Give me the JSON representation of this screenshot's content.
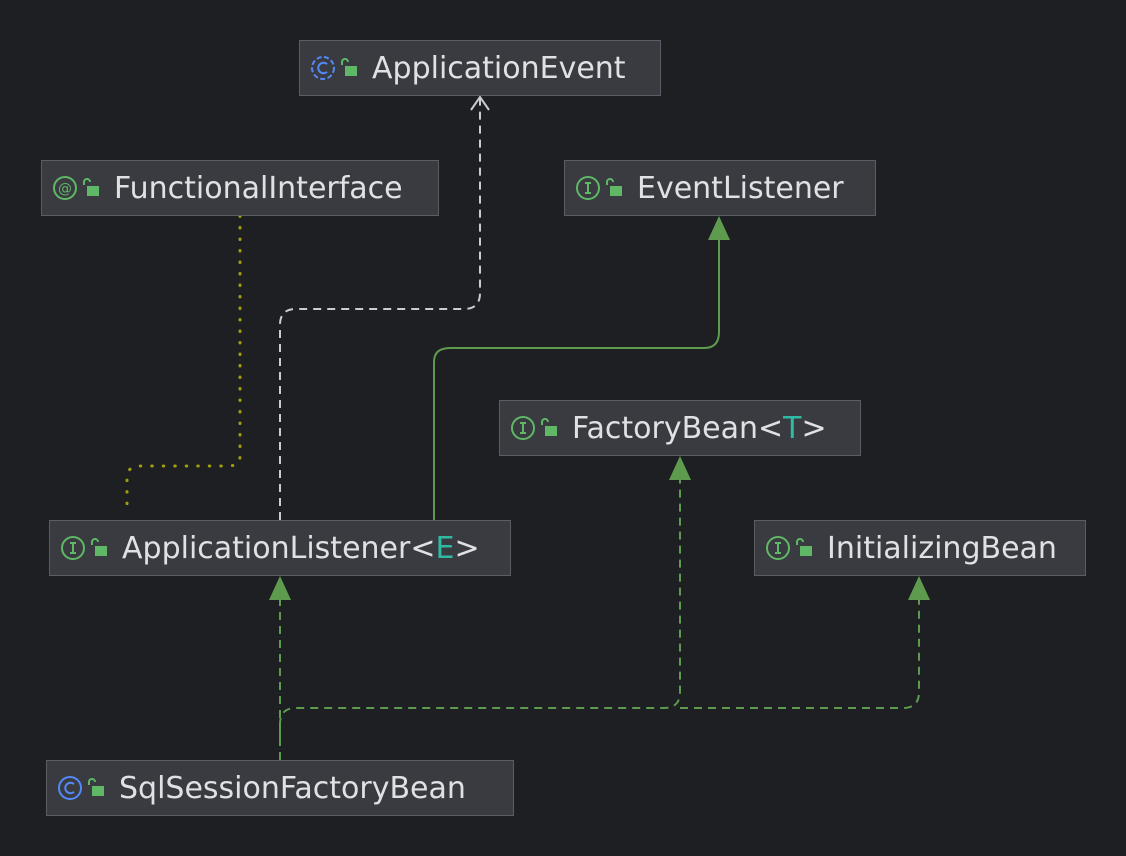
{
  "diagram": {
    "nodes": [
      {
        "id": "application-event",
        "name": "ApplicationEvent",
        "kind": "class",
        "type_param": null
      },
      {
        "id": "functional-interface",
        "name": "FunctionalInterface",
        "kind": "annotation",
        "type_param": null
      },
      {
        "id": "event-listener",
        "name": "EventListener",
        "kind": "interface",
        "type_param": null
      },
      {
        "id": "factory-bean",
        "name": "FactoryBean",
        "kind": "interface",
        "type_param": "T"
      },
      {
        "id": "application-listener",
        "name": "ApplicationListener",
        "kind": "interface",
        "type_param": "E"
      },
      {
        "id": "initializing-bean",
        "name": "InitializingBean",
        "kind": "interface",
        "type_param": null
      },
      {
        "id": "sql-session-factory-bean",
        "name": "SqlSessionFactoryBean",
        "kind": "class",
        "type_param": null
      }
    ],
    "edges": [
      {
        "from": "application-listener",
        "to": "application-event",
        "relation": "dependency"
      },
      {
        "from": "application-listener",
        "to": "event-listener",
        "relation": "extends"
      },
      {
        "from": "application-listener",
        "to": "functional-interface",
        "relation": "annotated-by"
      },
      {
        "from": "sql-session-factory-bean",
        "to": "application-listener",
        "relation": "implements"
      },
      {
        "from": "sql-session-factory-bean",
        "to": "factory-bean",
        "relation": "implements"
      },
      {
        "from": "sql-session-factory-bean",
        "to": "initializing-bean",
        "relation": "implements"
      }
    ]
  },
  "colors": {
    "background": "#1e1f22",
    "node_fill": "#393b40",
    "node_border": "#5a5d63",
    "text": "#dfe1e5",
    "type_param": "#2fbaa3",
    "class_icon": "#548af7",
    "interface_icon": "#5fb865",
    "lock_icon": "#5fb865",
    "edge_green": "#5e9b4f",
    "edge_dependency": "#c9ccd1",
    "edge_annotation": "#a0a00c"
  }
}
